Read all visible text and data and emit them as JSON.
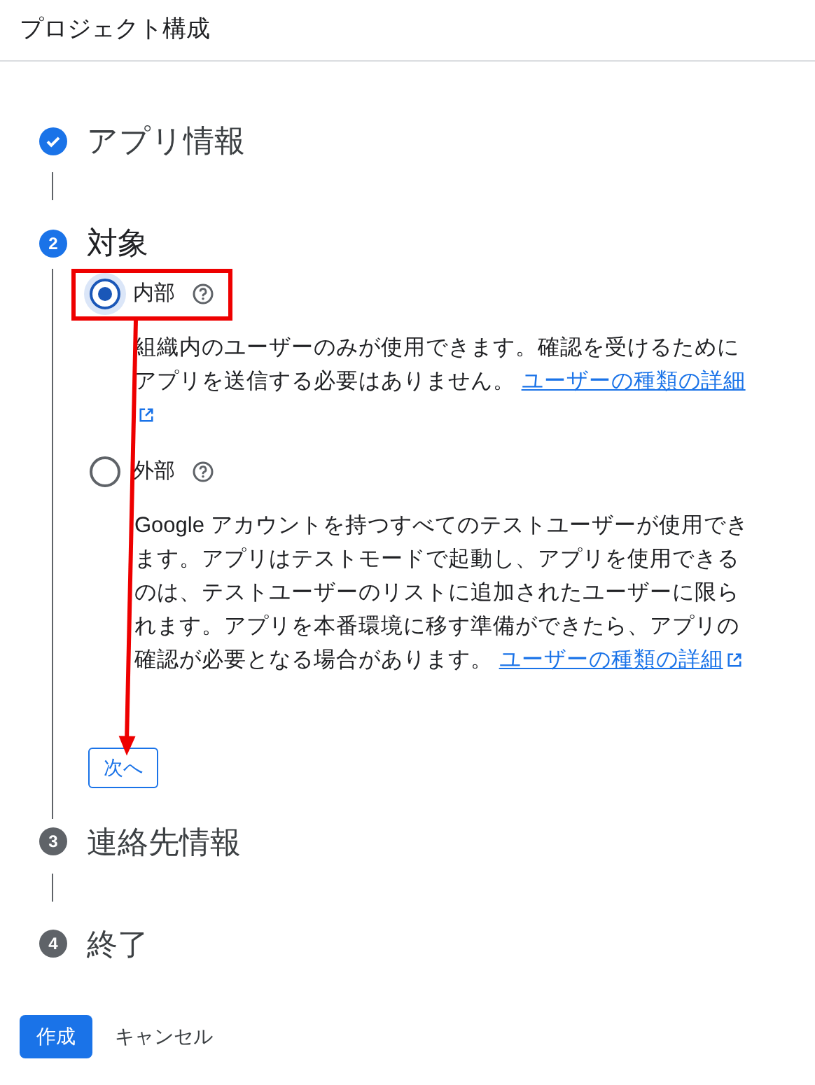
{
  "header": {
    "title": "プロジェクト構成"
  },
  "steps": [
    {
      "label": "アプリ情報",
      "completed": true,
      "current": false
    },
    {
      "number": "2",
      "label": "対象",
      "completed": false,
      "current": true,
      "options": [
        {
          "label": "内部",
          "selected": true,
          "highlighted": true,
          "description": "組織内のユーザーのみが使用できます。確認を受けるためにアプリを送信する必要はありません。",
          "link": "ユーザーの種類の詳細"
        },
        {
          "label": "外部",
          "selected": false,
          "highlighted": false,
          "description": "Google アカウントを持つすべてのテストユーザーが使用できます。アプリはテストモードで起動し、アプリを使用できるのは、テストユーザーのリストに追加されたユーザーに限られます。アプリを本番環境に移す準備ができたら、アプリの確認が必要となる場合があります。",
          "link": "ユーザーの種類の詳細"
        }
      ],
      "next_button": "次へ",
      "arrow": true
    },
    {
      "number": "3",
      "label": "連絡先情報",
      "completed": false,
      "current": false
    },
    {
      "number": "4",
      "label": "終了",
      "completed": false,
      "current": false
    }
  ],
  "footer": {
    "primary": "作成",
    "secondary": "キャンセル"
  }
}
